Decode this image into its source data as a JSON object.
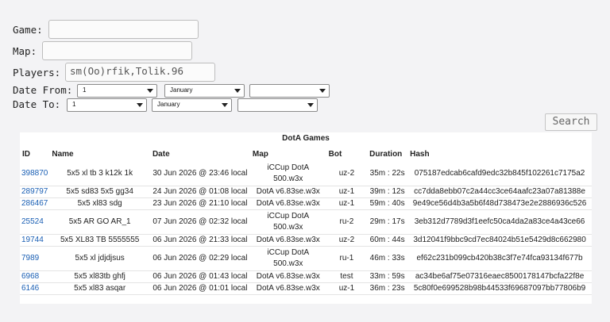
{
  "form": {
    "game_label": "Game:",
    "game_value": "",
    "map_label": "Map:",
    "map_value": "",
    "players_label": "Players:",
    "players_value": "sm(Oo)rfik,Tolik.96",
    "date_from_label": "Date From:",
    "date_to_label": "Date To:",
    "date_from": {
      "day": "1",
      "month": "January",
      "year": ""
    },
    "date_to": {
      "day": "1",
      "month": "January",
      "year": ""
    },
    "search_label": "Search"
  },
  "table": {
    "caption": "DotA Games",
    "headers": [
      "ID",
      "Name",
      "Date",
      "Map",
      "Bot",
      "Duration",
      "Hash"
    ],
    "rows": [
      {
        "id": "398870",
        "name": "5x5 xl tb 3 k12k 1k",
        "date": "30 Jun 2026 @ 23:46 local",
        "map": "iCCup DotA 500.w3x",
        "bot": "uz-2",
        "duration": "35m : 22s",
        "hash": "075187edcab6cafd9edc32b845f102261c7175a2"
      },
      {
        "id": "289797",
        "name": "5x5 sd83 5x5 gg34",
        "date": "24 Jun 2026 @ 01:08 local",
        "map": "DotA v6.83se.w3x",
        "bot": "uz-1",
        "duration": "39m : 12s",
        "hash": "cc7dda8ebb07c2a44cc3ce64aafc23a07a81388e"
      },
      {
        "id": "286467",
        "name": "5x5 xl83 sdg",
        "date": "23 Jun 2026 @ 21:10 local",
        "map": "DotA v6.83se.w3x",
        "bot": "uz-1",
        "duration": "59m : 40s",
        "hash": "9e49ce56d4b3a5b6f48d738473e2e2886936c526"
      },
      {
        "id": "25524",
        "name": "5x5 AR GO AR_1",
        "date": "07 Jun 2026 @ 02:32 local",
        "map": "iCCup DotA 500.w3x",
        "bot": "ru-2",
        "duration": "29m : 17s",
        "hash": "3eb312d7789d3f1eefc50ca4da2a83ce4a43ce66"
      },
      {
        "id": "19744",
        "name": "5x5 XL83 TB 5555555",
        "date": "06 Jun 2026 @ 21:33 local",
        "map": "DotA v6.83se.w3x",
        "bot": "uz-2",
        "duration": "60m : 44s",
        "hash": "3d12041f9bbc9cd7ec84024b51e5429d8c662980"
      },
      {
        "id": "7989",
        "name": "5x5 xl jdjdjsus",
        "date": "06 Jun 2026 @ 02:29 local",
        "map": "iCCup DotA 500.w3x",
        "bot": "ru-1",
        "duration": "46m : 33s",
        "hash": "ef62c231b099cb420b38c3f7e74fca93134f677b"
      },
      {
        "id": "6968",
        "name": "5x5 xl83tb ghfj",
        "date": "06 Jun 2026 @ 01:43 local",
        "map": "DotA v6.83se.w3x",
        "bot": "test",
        "duration": "33m : 59s",
        "hash": "ac34be6af75e07316eaec8500178147bcfa22f8e"
      },
      {
        "id": "6146",
        "name": "5x5 xl83 asqar",
        "date": "06 Jun 2026 @ 01:01 local",
        "map": "DotA v6.83se.w3x",
        "bot": "uz-1",
        "duration": "36m : 23s",
        "hash": "5c80f0e699528b98b44533f69687097bb77806b9"
      }
    ]
  }
}
